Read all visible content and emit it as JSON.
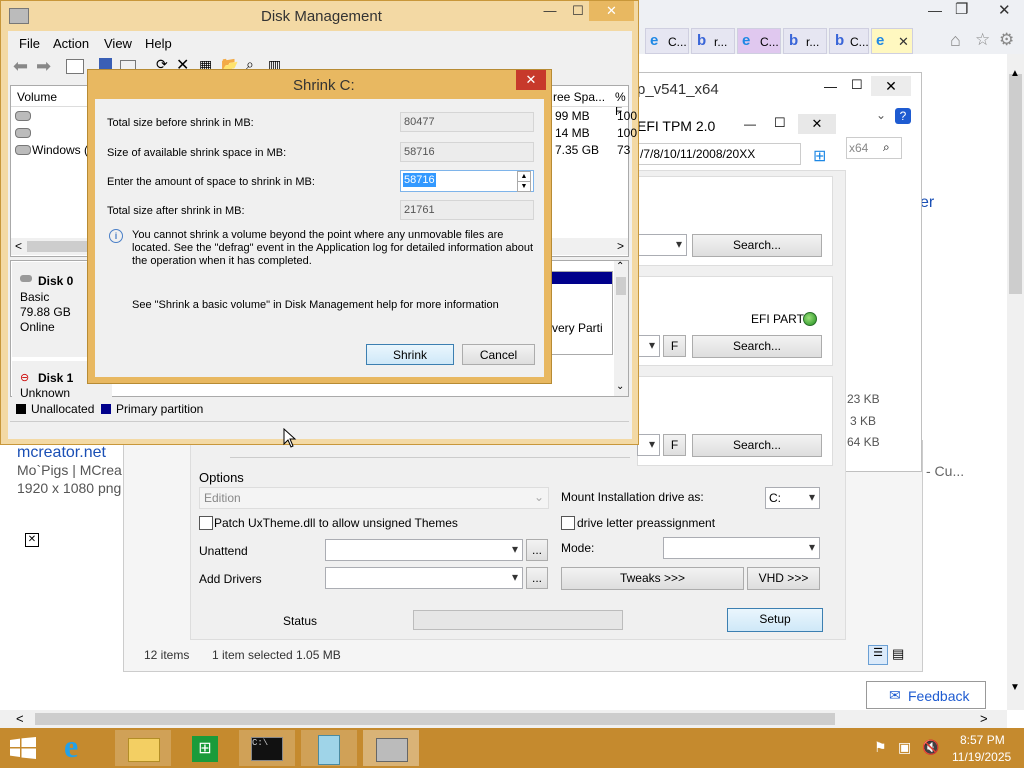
{
  "browser": {
    "tabs": [
      {
        "icon": "ie-icon",
        "label": "C..."
      },
      {
        "icon": "bing-icon",
        "label": "r..."
      },
      {
        "icon": "ie-icon",
        "label": "C..."
      },
      {
        "icon": "bing-icon",
        "label": "r..."
      },
      {
        "icon": "bing-icon",
        "label": "C..."
      }
    ],
    "page_link": "mcreator.net",
    "page_line2": "Mo`Pigs | MCrea",
    "page_line3": "1920 x 1080 png",
    "page_right_text": "- Cu...",
    "side_link": "er",
    "feedback_label": "Feedback"
  },
  "winntsetup": {
    "title": "p_v541_x64",
    "efi_title": "EFI   TPM 2.0",
    "os_path": "/7/8/10/11/2008/20XX",
    "search_box": "x64",
    "search_label": "Search...",
    "efi_part_label": "EFI PART",
    "f_label": "F",
    "sizes": [
      "23 KB",
      "3 KB",
      "64 KB"
    ],
    "options_title": "Options",
    "edition_label": "Edition",
    "patch_label": "Patch UxTheme.dll to allow unsigned Themes",
    "mount_label": "Mount Installation drive as:",
    "mount_value": "C:",
    "drive_letter_label": "drive letter preassignment",
    "unattend_label": "Unattend",
    "mode_label": "Mode:",
    "add_drivers_label": "Add Drivers",
    "dots_label": "...",
    "tweaks_label": "Tweaks >>>",
    "vhd_label": "VHD >>>",
    "status_label": "Status",
    "setup_label": "Setup"
  },
  "explorer_status": {
    "items": "12 items",
    "selected": "1 item selected  1.05 MB"
  },
  "disk_mgmt": {
    "title": "Disk Management",
    "menu": [
      "File",
      "Action",
      "View",
      "Help"
    ],
    "columns": {
      "volume": "Volume",
      "free_space": "ree Spa...",
      "pct": "% F"
    },
    "rows": [
      {
        "volume": "",
        "free": "99 MB",
        "pct": "100"
      },
      {
        "volume": "",
        "free": "14 MB",
        "pct": "100"
      },
      {
        "volume": "Windows (",
        "free": "7.35 GB",
        "pct": "73"
      }
    ],
    "disk0": {
      "name": "Disk 0",
      "type": "Basic",
      "size": "79.88 GB",
      "status": "Online"
    },
    "disk1": {
      "name": "Disk 1",
      "type": "Unknown"
    },
    "recovery_label": "very Parti",
    "legend": {
      "unallocated": "Unallocated",
      "primary": "Primary partition"
    }
  },
  "shrink_dialog": {
    "title": "Shrink C:",
    "total_before_label": "Total size before shrink in MB:",
    "total_before_value": "80477",
    "available_label": "Size of available shrink space in MB:",
    "available_value": "58716",
    "amount_label": "Enter the amount of space to shrink in MB:",
    "amount_value": "58716",
    "after_label": "Total size after shrink in MB:",
    "after_value": "21761",
    "info_text": "You cannot shrink a volume beyond the point where any unmovable files are located. See the \"defrag\" event in the Application log for detailed information about the operation when it has completed.",
    "help_text": "See \"Shrink a basic volume\" in Disk Management help for more information",
    "shrink_button": "Shrink",
    "cancel_button": "Cancel"
  },
  "taskbar": {
    "time": "8:57 PM",
    "date": "11/19/2025"
  },
  "colors": {
    "taskbar": "#c58a2e",
    "dialog_frame": "#e8b861",
    "close_red": "#c7392b",
    "primary_partition": "#00008b"
  }
}
